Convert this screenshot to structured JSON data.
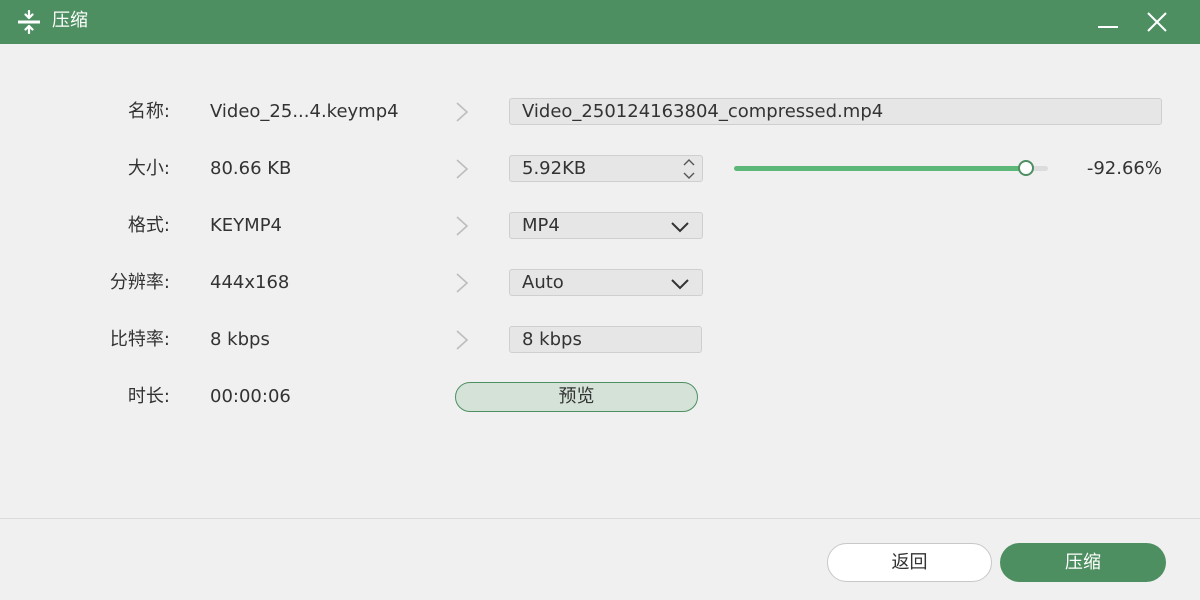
{
  "window": {
    "title": "压缩",
    "minimize_icon": "minimize-icon",
    "close_icon": "close-icon"
  },
  "rows": {
    "name": {
      "label": "名称:",
      "source": "Video_25...4.keymp4",
      "output": "Video_250124163804_compressed.mp4"
    },
    "size": {
      "label": "大小:",
      "source": "80.66 KB",
      "output": "5.92KB",
      "slider_fraction": 0.9266,
      "percent": "-92.66%"
    },
    "format": {
      "label": "格式:",
      "source": "KEYMP4",
      "output": "MP4"
    },
    "resolution": {
      "label": "分辨率:",
      "source": "444x168",
      "output": "Auto"
    },
    "bitrate": {
      "label": "比特率:",
      "source": "8 kbps",
      "output": "8 kbps"
    },
    "duration": {
      "label": "时长:",
      "source": "00:00:06",
      "preview": "预览"
    }
  },
  "footer": {
    "back": "返回",
    "compress": "压缩"
  },
  "colors": {
    "accent": "#4e8f62",
    "slider": "#5cb878",
    "preview_bg": "#d5e2d8"
  }
}
